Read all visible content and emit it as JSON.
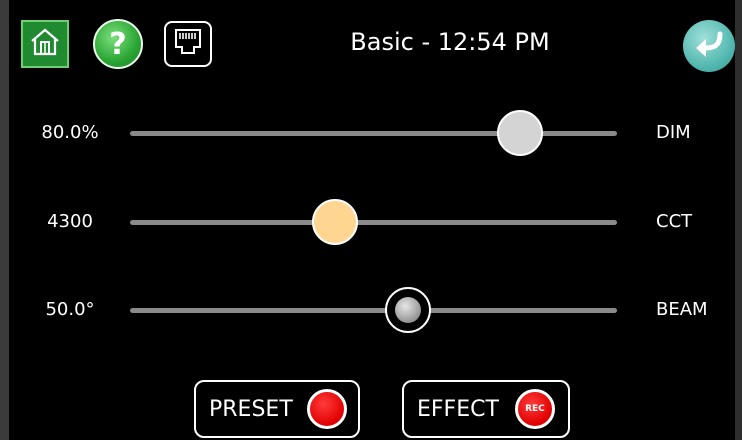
{
  "header": {
    "title": "Basic - 12:54 PM",
    "home_icon": "home-icon",
    "help_icon": "question-icon",
    "help_glyph": "?",
    "network_icon": "ethernet-port-icon",
    "back_icon": "return-arrow-icon"
  },
  "sliders": [
    {
      "value": "80.0%",
      "name": "DIM",
      "level": 0.8,
      "knob_color": "#d4d4d4"
    },
    {
      "value": "4300",
      "name": "CCT",
      "level": 0.42,
      "knob_color": "#ffd592"
    },
    {
      "value": "50.0°",
      "name": "BEAM",
      "level": 0.57,
      "knob_color": "#8a8a8a"
    }
  ],
  "footer": {
    "preset_label": "PRESET",
    "effect_label": "EFFECT",
    "rec_badge": "REC"
  },
  "colors": {
    "home_green": "#1f8a2f",
    "help_green": "#2aa534",
    "back_teal": "#4fb6ad",
    "record_red": "#e00000"
  }
}
